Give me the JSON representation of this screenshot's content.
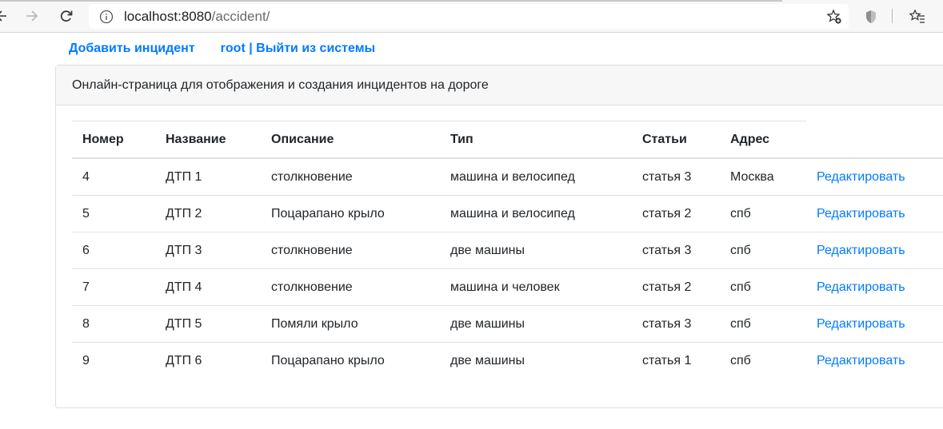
{
  "browser": {
    "url_host": "localhost:8080",
    "url_path": "/accident/"
  },
  "nav": {
    "add_incident": "Добавить инцидент",
    "user_logout": "root | Выйти из системы"
  },
  "card": {
    "header": "Онлайн-страница для отображения и создания инцидентов на дороге"
  },
  "table": {
    "columns": [
      "Номер",
      "Название",
      "Описание",
      "Тип",
      "Статьи",
      "Адрес"
    ],
    "rows": [
      {
        "num": "4",
        "name": "ДТП 1",
        "desc": "столкновение",
        "type": "машина и велосипед",
        "article": "статья 3",
        "address": "Москва",
        "action": "Редактировать"
      },
      {
        "num": "5",
        "name": "ДТП 2",
        "desc": "Поцарапано крыло",
        "type": "машина и велосипед",
        "article": "статья 2",
        "address": "спб",
        "action": "Редактировать"
      },
      {
        "num": "6",
        "name": "ДТП 3",
        "desc": "столкновение",
        "type": "две машины",
        "article": "статья 3",
        "address": "спб",
        "action": "Редактировать"
      },
      {
        "num": "7",
        "name": "ДТП 4",
        "desc": "столкновение",
        "type": "машина и человек",
        "article": "статья 2",
        "address": "спб",
        "action": "Редактировать"
      },
      {
        "num": "8",
        "name": "ДТП 5",
        "desc": "Помяли крыло",
        "type": "две машины",
        "article": "статья 3",
        "address": "спб",
        "action": "Редактировать"
      },
      {
        "num": "9",
        "name": "ДТП 6",
        "desc": "Поцарапано крыло",
        "type": "две машины",
        "article": "статья 1",
        "address": "спб",
        "action": "Редактировать"
      }
    ]
  }
}
